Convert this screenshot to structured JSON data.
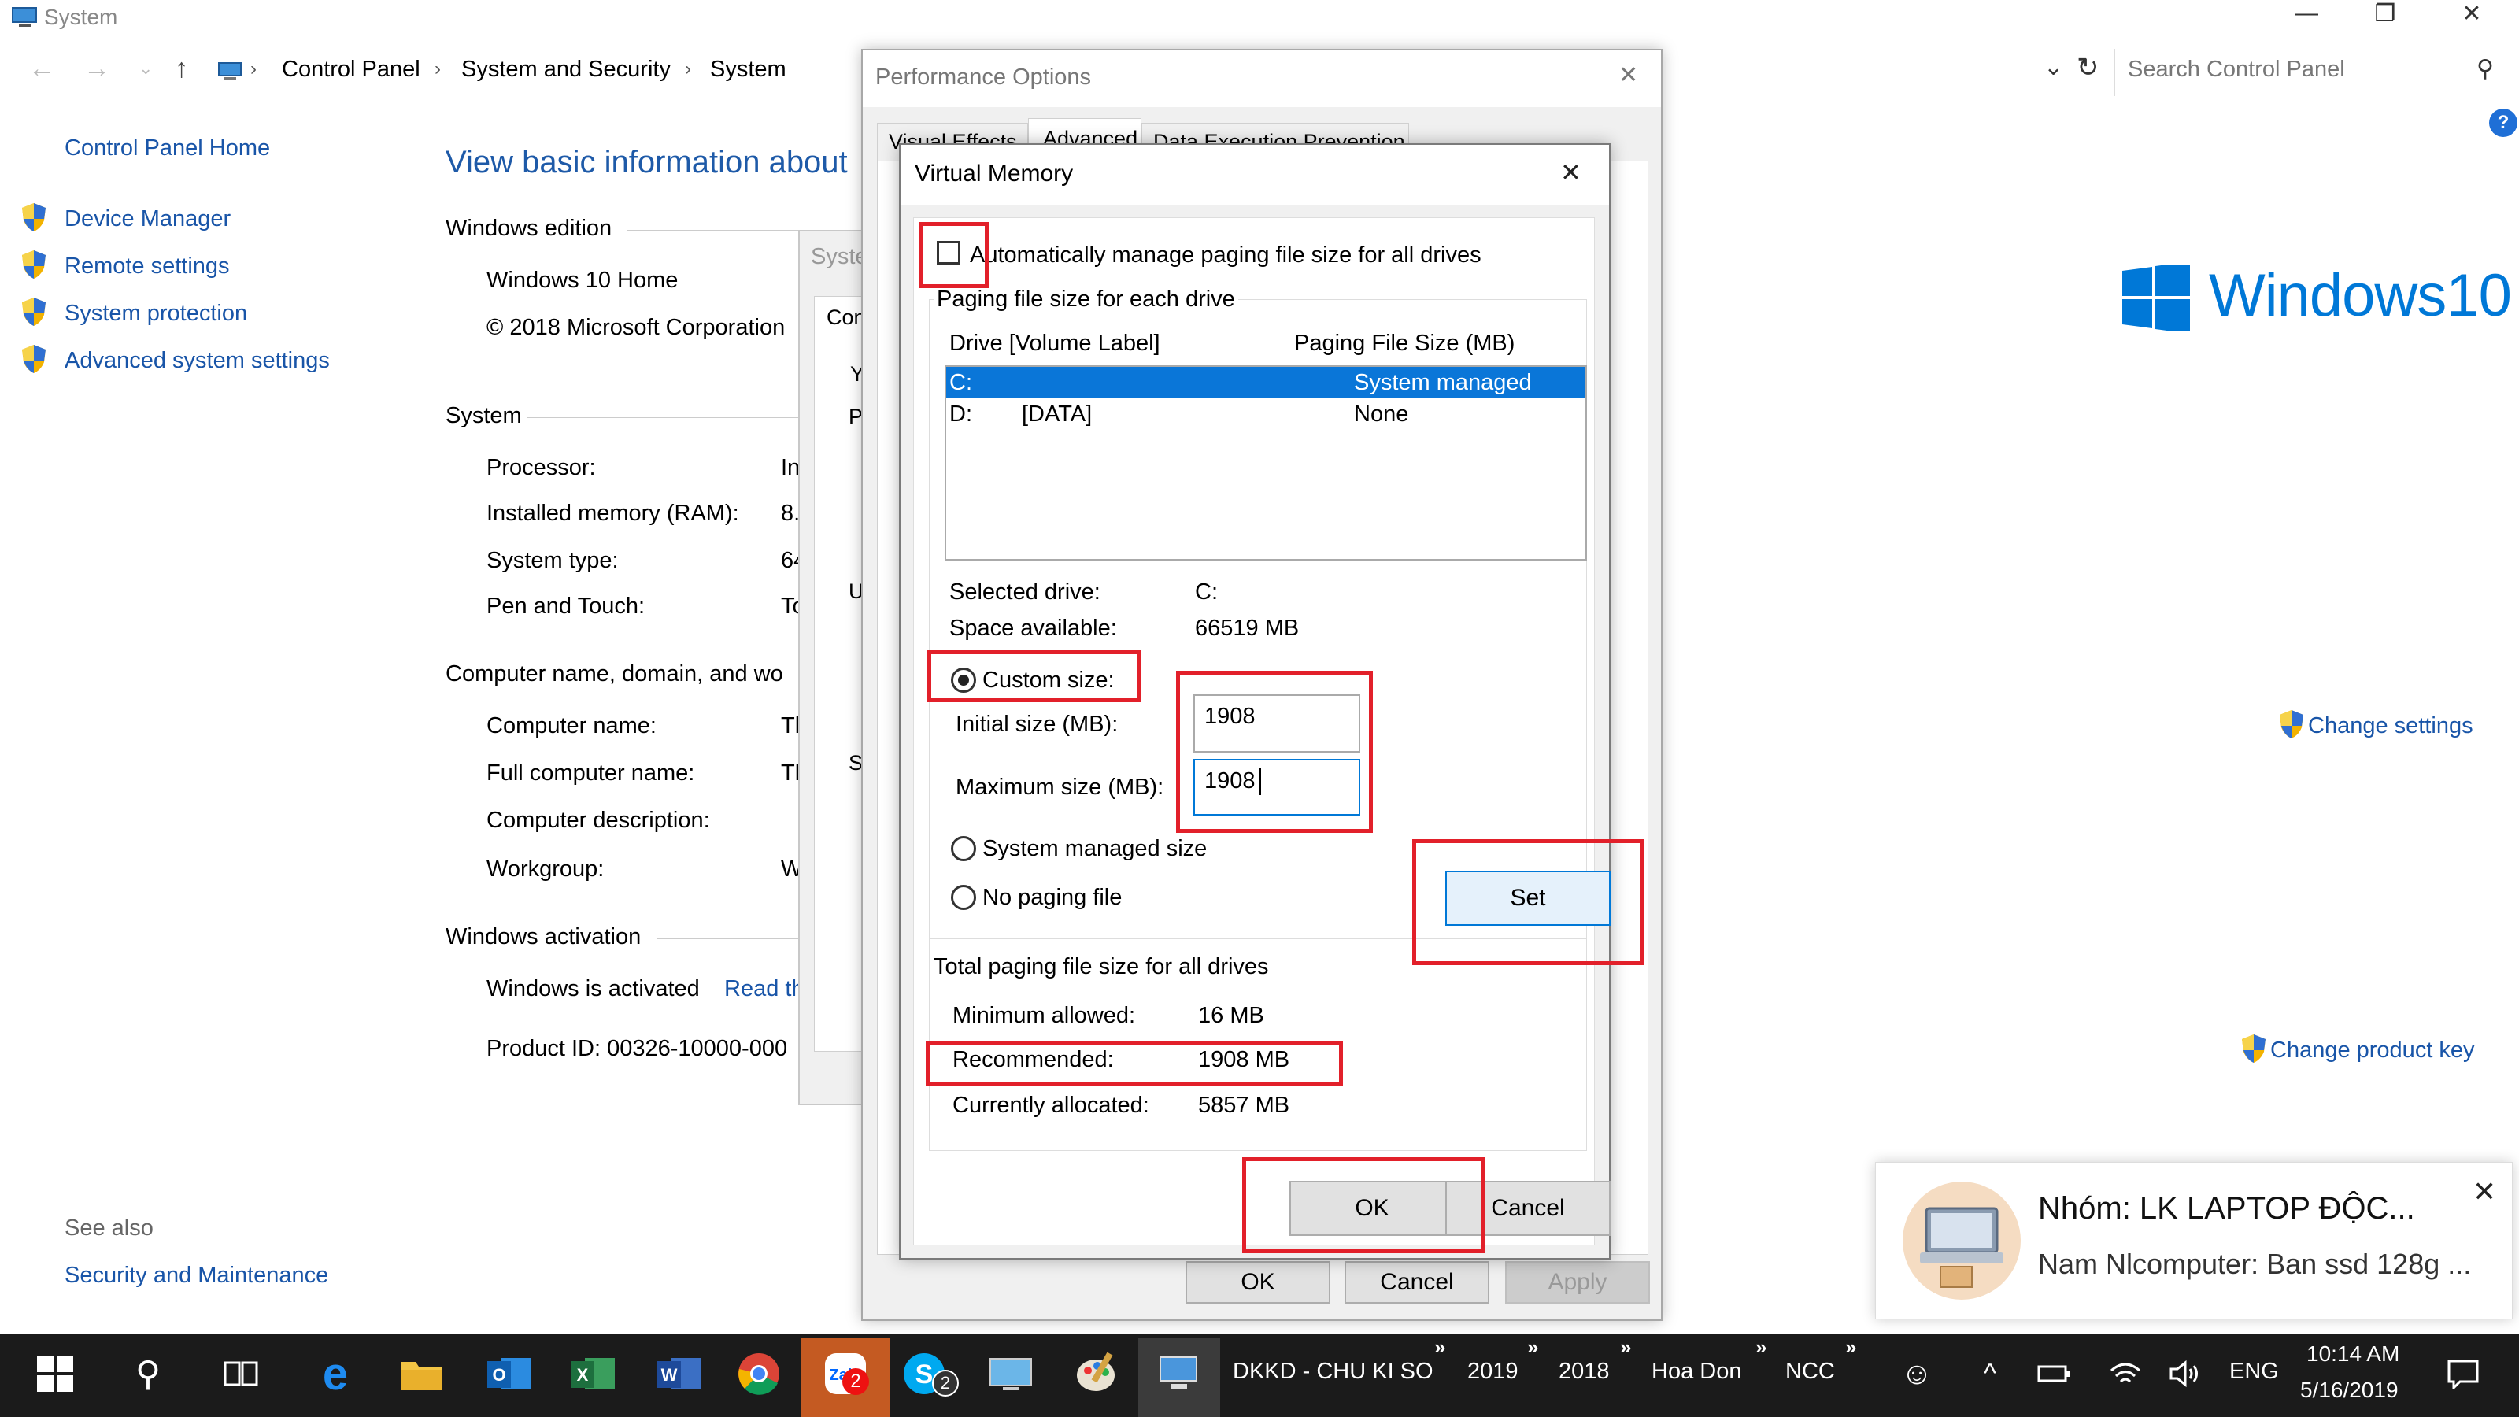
{
  "window": {
    "title": "System"
  },
  "address": {
    "crumbs": [
      "Control Panel",
      "System and Security",
      "System"
    ],
    "search_placeholder": "Search Control Panel"
  },
  "sidebar": {
    "home": "Control Panel Home",
    "items": [
      "Device Manager",
      "Remote settings",
      "System protection",
      "Advanced system settings"
    ],
    "see_also_title": "See also",
    "see_also": [
      "Security and Maintenance"
    ]
  },
  "main": {
    "heading": "View basic information about",
    "windows_edition": {
      "title": "Windows edition",
      "edition": "Windows 10 Home",
      "copyright": "© 2018 Microsoft Corporation"
    },
    "system": {
      "title": "System",
      "rows": [
        {
          "label": "Processor:",
          "value": "In"
        },
        {
          "label": "Installed memory (RAM):",
          "value": "8."
        },
        {
          "label": "System type:",
          "value": "64"
        },
        {
          "label": "Pen and Touch:",
          "value": "To"
        }
      ]
    },
    "computer": {
      "title": "Computer name, domain, and wo",
      "rows": [
        {
          "label": "Computer name:",
          "value": "Tl"
        },
        {
          "label": "Full computer name:",
          "value": "Tl"
        },
        {
          "label": "Computer description:",
          "value": ""
        },
        {
          "label": "Workgroup:",
          "value": "W"
        }
      ]
    },
    "activation": {
      "title": "Windows activation",
      "status": "Windows is activated",
      "read_link": "Read th",
      "product_id": "Product ID:  00326-10000-000"
    },
    "change_settings": "Change settings",
    "change_product_key": "Change product key",
    "logo_text": "Windows10"
  },
  "sysprops": {
    "title": "Syste",
    "tab": "Con",
    "letters": [
      "Y",
      "P",
      "U",
      "S"
    ]
  },
  "perf": {
    "title": "Performance Options",
    "tabs": [
      "Visual Effects",
      "Advanced",
      "Data Execution Prevention"
    ],
    "buttons": {
      "ok": "OK",
      "cancel": "Cancel",
      "apply": "Apply"
    }
  },
  "vm": {
    "title": "Virtual Memory",
    "auto_manage": "Automatically manage paging file size for all drives",
    "auto_manage_checked": false,
    "group_label": "Paging file size for each drive",
    "col_drive": "Drive  [Volume Label]",
    "col_size": "Paging File Size (MB)",
    "drives": [
      {
        "drive": "C:",
        "label": "",
        "size": "System managed",
        "selected": true
      },
      {
        "drive": "D:",
        "label": "[DATA]",
        "size": "None",
        "selected": false
      }
    ],
    "selected_drive_label": "Selected drive:",
    "selected_drive": "C:",
    "space_label": "Space available:",
    "space": "66519 MB",
    "custom_size": "Custom size:",
    "initial_label": "Initial size (MB):",
    "initial_value": "1908",
    "max_label": "Maximum size (MB):",
    "max_value": "1908",
    "system_managed": "System managed size",
    "no_paging": "No paging file",
    "set_button": "Set",
    "total_label": "Total paging file size for all drives",
    "min_label": "Minimum allowed:",
    "min_value": "16 MB",
    "rec_label": "Recommended:",
    "rec_value": "1908 MB",
    "cur_label": "Currently allocated:",
    "cur_value": "5857 MB",
    "ok": "OK",
    "cancel": "Cancel"
  },
  "notification": {
    "title": "Nhóm: LK LAPTOP ĐỘC...",
    "body": "Nam Nlcomputer: Ban ssd 128g ..."
  },
  "taskbar": {
    "toolbar_items": [
      "DKKD - CHU KI SO",
      "2019",
      "2018",
      "Hoa Don",
      "NCC"
    ],
    "zalo_badge": "2",
    "skype_badge": "2",
    "lang": "ENG",
    "time": "10:14 AM",
    "date": "5/16/2019"
  },
  "colors": {
    "accent": "#0078d7",
    "highlight": "#3399ff",
    "annotation": "#e2202a",
    "taskbar": "#1b1b1b"
  }
}
